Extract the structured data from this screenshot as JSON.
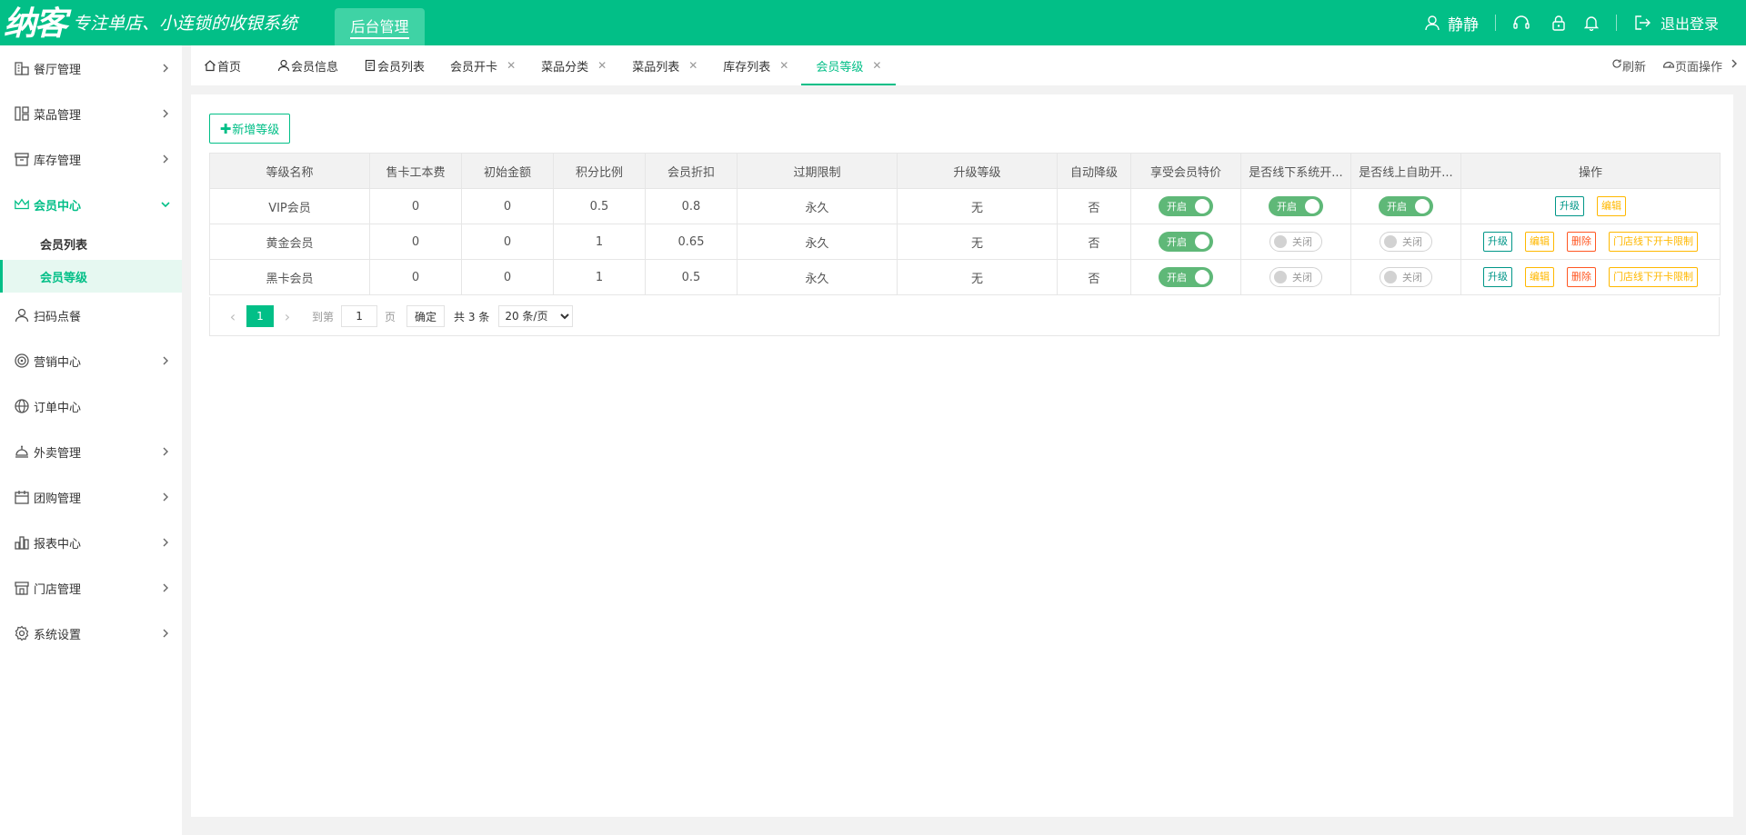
{
  "brand": {
    "logo": "纳客",
    "slogan": "专注单店、小连锁的收银系统"
  },
  "header": {
    "admin_tab": "后台管理",
    "user": "静静",
    "logout": "退出登录"
  },
  "sidebar": {
    "items": [
      {
        "label": "餐厅管理",
        "icon": "building-icon",
        "chevron": true
      },
      {
        "label": "菜品管理",
        "icon": "layout-icon",
        "chevron": true
      },
      {
        "label": "库存管理",
        "icon": "box-icon",
        "chevron": true
      },
      {
        "label": "会员中心",
        "icon": "crown-icon",
        "chevron": true,
        "expanded": true,
        "children": [
          {
            "label": "会员列表"
          },
          {
            "label": "会员等级",
            "active": true
          }
        ]
      },
      {
        "label": "扫码点餐",
        "icon": "user-icon",
        "chevron": false
      },
      {
        "label": "营销中心",
        "icon": "target-icon",
        "chevron": true
      },
      {
        "label": "订单中心",
        "icon": "globe-icon",
        "chevron": false
      },
      {
        "label": "外卖管理",
        "icon": "bell-tray-icon",
        "chevron": true
      },
      {
        "label": "团购管理",
        "icon": "calendar-icon",
        "chevron": true
      },
      {
        "label": "报表中心",
        "icon": "bar-chart-icon",
        "chevron": true
      },
      {
        "label": "门店管理",
        "icon": "store-icon",
        "chevron": true
      },
      {
        "label": "系统设置",
        "icon": "gear-icon",
        "chevron": true
      }
    ]
  },
  "tabs": {
    "items": [
      {
        "label": "首页",
        "icon": "home-icon",
        "closable": false
      },
      {
        "label": "会员信息",
        "icon": "user-icon",
        "closable": false
      },
      {
        "label": "会员列表",
        "icon": "doc-icon",
        "closable": false
      },
      {
        "label": "会员开卡",
        "closable": true
      },
      {
        "label": "菜品分类",
        "closable": true
      },
      {
        "label": "菜品列表",
        "closable": true
      },
      {
        "label": "库存列表",
        "closable": true
      },
      {
        "label": "会员等级",
        "closable": true,
        "active": true
      }
    ],
    "refresh": "刷新",
    "page_ops": "页面操作"
  },
  "main": {
    "add_button": "新增等级",
    "columns": [
      "等级名称",
      "售卡工本费",
      "初始金额",
      "积分比例",
      "会员折扣",
      "过期限制",
      "升级等级",
      "自动降级",
      "享受会员特价",
      "是否线下系统开...",
      "是否线上自助开...",
      "操作"
    ],
    "rows": [
      {
        "name": "VIP会员",
        "card_fee": "0",
        "init_amount": "0",
        "points_ratio": "0.5",
        "discount": "0.8",
        "expire": "永久",
        "upgrade": "无",
        "auto_down": "否",
        "special": true,
        "offline": true,
        "online": true,
        "ops": [
          "升级",
          "编辑"
        ]
      },
      {
        "name": "黄金会员",
        "card_fee": "0",
        "init_amount": "0",
        "points_ratio": "1",
        "discount": "0.65",
        "expire": "永久",
        "upgrade": "无",
        "auto_down": "否",
        "special": true,
        "offline": false,
        "online": false,
        "ops": [
          "升级",
          "编辑",
          "删除",
          "门店线下开卡限制"
        ]
      },
      {
        "name": "黑卡会员",
        "card_fee": "0",
        "init_amount": "0",
        "points_ratio": "1",
        "discount": "0.5",
        "expire": "永久",
        "upgrade": "无",
        "auto_down": "否",
        "special": true,
        "offline": false,
        "online": false,
        "ops": [
          "升级",
          "编辑",
          "删除",
          "门店线下开卡限制"
        ]
      }
    ],
    "switch_on": "开启",
    "switch_off": "关闭",
    "pager": {
      "current_page": "1",
      "goto_label": "到第",
      "goto_value": "1",
      "page_unit": "页",
      "confirm": "确定",
      "total": "共 3 条",
      "page_size_selected": "20 条/页"
    }
  },
  "colors": {
    "brand": "#02bf87",
    "switch_on": "#5fb878",
    "op_green": "#009688",
    "op_orange": "#ffb800",
    "op_red": "#ff5722"
  }
}
